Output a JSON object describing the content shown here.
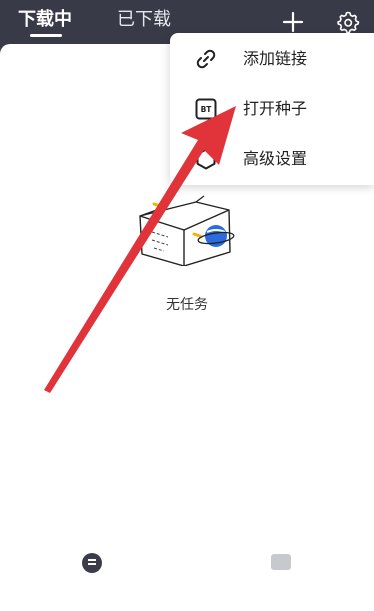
{
  "header": {
    "tabs": [
      {
        "label": "下载中",
        "active": true
      },
      {
        "label": "已下载",
        "active": false
      }
    ],
    "add_icon": "plus-icon",
    "settings_icon": "gear-icon"
  },
  "menu": {
    "items": [
      {
        "label": "添加链接",
        "icon": "link-icon"
      },
      {
        "label": "打开种子",
        "icon": "bt-torrent-icon"
      },
      {
        "label": "高级设置",
        "icon": "hexagon-settings-icon"
      }
    ]
  },
  "main": {
    "empty_text": "无任务"
  },
  "bottom_nav": {
    "items": [
      {
        "icon": "download-list-icon"
      },
      {
        "icon": "folder-icon"
      }
    ]
  },
  "colors": {
    "header_bg": "#393a48",
    "annotation_arrow": "#e0343a"
  }
}
